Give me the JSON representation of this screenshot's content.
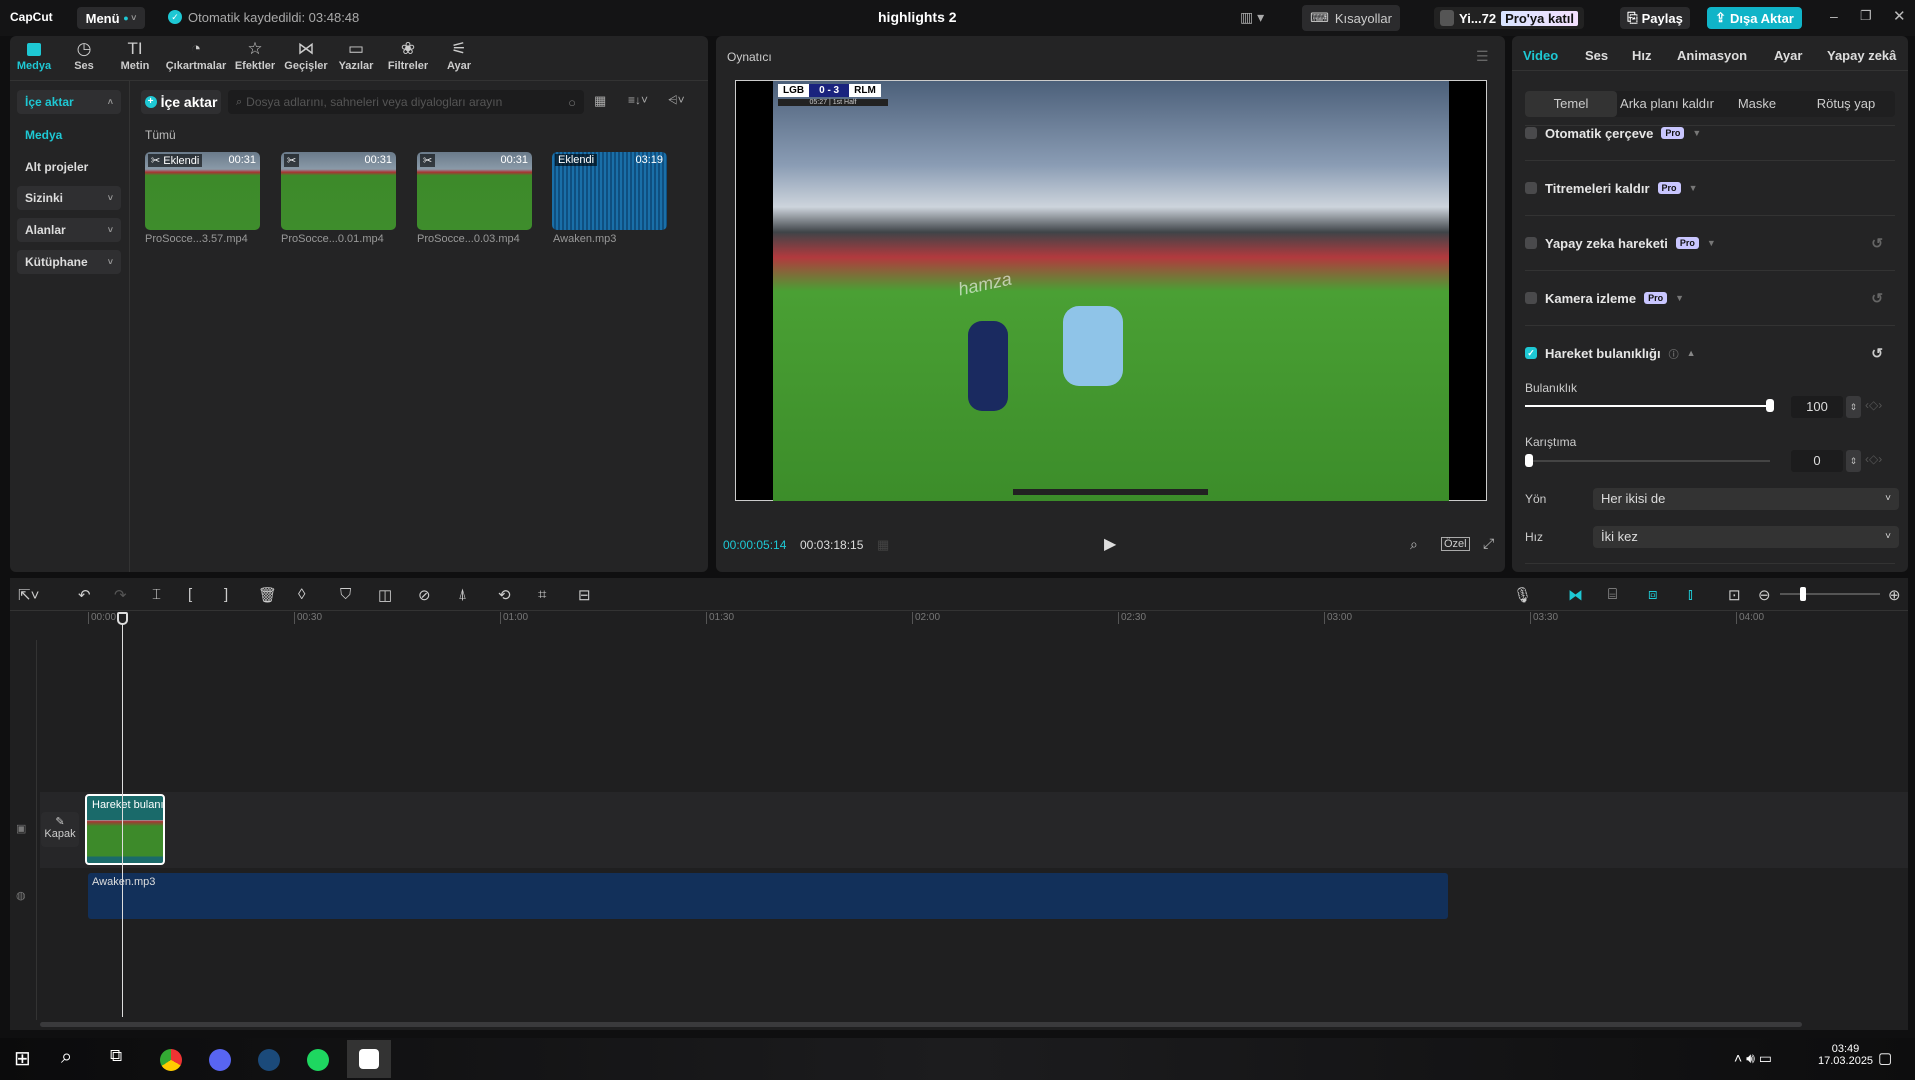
{
  "app": {
    "logo": "CapCut",
    "menu": "Menü",
    "autosave": "Otomatik kaydedildi: 03:48:48",
    "title": "highlights 2",
    "shortcuts": "Kısayollar",
    "user": "Yi...72",
    "pro_join": "Pro'ya katıl",
    "share": "Paylaş",
    "export": "Dışa Aktar"
  },
  "toolbar": [
    {
      "label": "Medya",
      "icon": "media-icon"
    },
    {
      "label": "Ses",
      "icon": "audio-icon"
    },
    {
      "label": "Metin",
      "icon": "text-icon"
    },
    {
      "label": "Çıkartmalar",
      "icon": "sticker-icon"
    },
    {
      "label": "Efektler",
      "icon": "effects-icon"
    },
    {
      "label": "Geçişler",
      "icon": "transitions-icon"
    },
    {
      "label": "Yazılar",
      "icon": "captions-icon"
    },
    {
      "label": "Filtreler",
      "icon": "filters-icon"
    },
    {
      "label": "Ayar",
      "icon": "adjust-icon"
    }
  ],
  "sidebar": {
    "import": "İçe aktar",
    "media": "Medya",
    "subprojects": "Alt projeler",
    "yours": "Sizinki",
    "spaces": "Alanlar",
    "library": "Kütüphane"
  },
  "media": {
    "import_button": "İçe aktar",
    "search_placeholder": "Dosya adlarını, sahneleri veya diyalogları arayın",
    "filter_all": "Tümü",
    "items": [
      {
        "name": "ProSocce...3.57.mp4",
        "badge": "Eklendi",
        "duration": "00:31"
      },
      {
        "name": "ProSocce...0.01.mp4",
        "badge": "",
        "duration": "00:31"
      },
      {
        "name": "ProSocce...0.03.mp4",
        "badge": "",
        "duration": "00:31"
      },
      {
        "name": "Awaken.mp3",
        "badge": "Eklendi",
        "duration": "03:19"
      }
    ]
  },
  "player": {
    "title": "Oynatıcı",
    "current_time": "00:00:05:14",
    "total_time": "00:03:18:15",
    "ratio_button": "Özel",
    "scoreboard": {
      "home": "LGB",
      "score": "0 - 3",
      "away": "RLM",
      "clock": "05:27 | 1st Half"
    },
    "watermark_text": "hamza"
  },
  "right_panel": {
    "tabs": [
      "Video",
      "Ses",
      "Hız",
      "Animasyon",
      "Ayar",
      "Yapay zekâ"
    ],
    "active_tab": "Video",
    "subtabs": [
      "Temel",
      "Arka planı kaldır",
      "Maske",
      "Rötuş yap"
    ],
    "active_subtab": "Temel",
    "effects": [
      {
        "label": "Otomatik çerçeve",
        "pro": "Pro",
        "checked": false
      },
      {
        "label": "Titremeleri kaldır",
        "pro": "Pro",
        "checked": false
      },
      {
        "label": "Yapay zeka hareketi",
        "pro": "Pro",
        "checked": false
      },
      {
        "label": "Kamera izleme",
        "pro": "Pro",
        "checked": false
      },
      {
        "label": "Hareket bulanıklığı",
        "pro": "",
        "checked": true
      }
    ],
    "blur_label": "Bulanıklık",
    "blur_value": "100",
    "blur_fraction": 1.0,
    "mix_label": "Karıştıma",
    "mix_value": "0",
    "mix_fraction": 0,
    "direction_label": "Yön",
    "direction_value": "Her ikisi de",
    "speed_label": "Hız",
    "speed_value": "İki kez"
  },
  "timeline": {
    "ticks": [
      "00:00",
      "00:30",
      "01:00",
      "01:30",
      "02:00",
      "02:30",
      "03:00",
      "03:30",
      "04:00"
    ],
    "cover_label": "Kapak",
    "video_clip_label": "Hareket bulanıklığı",
    "audio_clip_label": "Awaken.mp3"
  },
  "taskbar": {
    "time": "03:49",
    "date": "17.03.2025"
  },
  "colors": {
    "accent": "#1ec8d4",
    "audio_clip": "#12305a",
    "export": "#10b4c8"
  }
}
